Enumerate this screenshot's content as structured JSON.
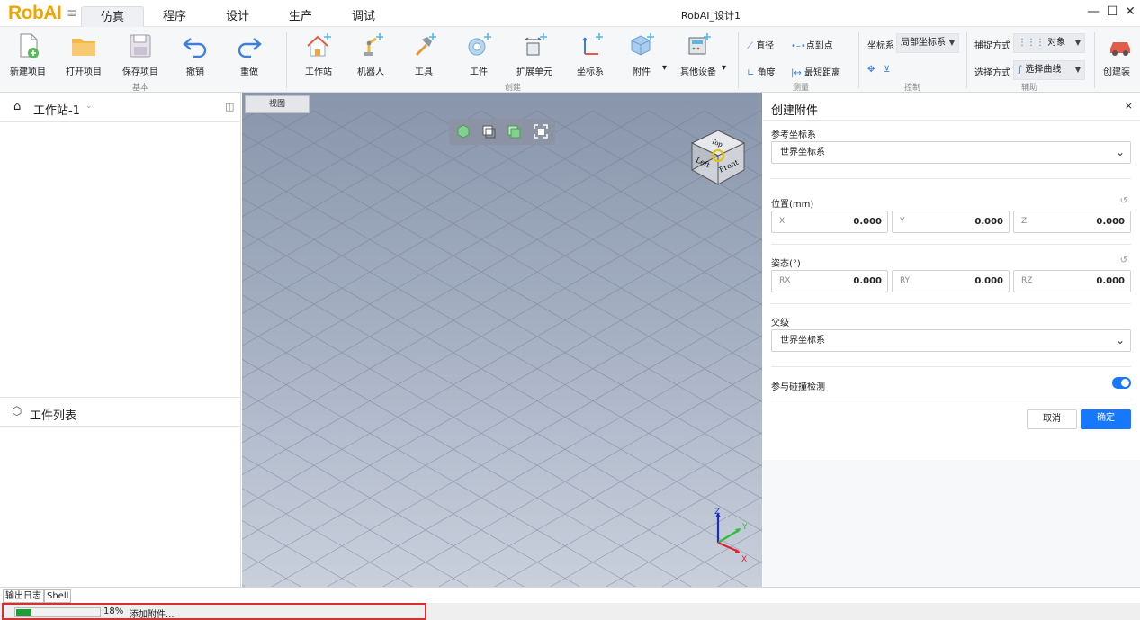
{
  "app": {
    "logo": "RobAI",
    "window_title": "RobAI_设计1"
  },
  "main_tabs": [
    "仿真",
    "程序",
    "设计",
    "生产",
    "调试"
  ],
  "active_tab_index": 0,
  "window_controls": {
    "minimize": "—",
    "maximize": "☐",
    "close": "✕"
  },
  "ribbon": {
    "basic": {
      "label": "基本",
      "buttons": [
        "新建项目",
        "打开项目",
        "保存项目",
        "撤销",
        "重做"
      ]
    },
    "create": {
      "label": "创建",
      "buttons": [
        "工作站",
        "机器人",
        "工具",
        "工件",
        "扩展单元",
        "坐标系",
        "附件",
        "其他设备"
      ]
    },
    "measure": {
      "label": "测量",
      "items": [
        "直径",
        "点到点",
        "角度",
        "最短距离"
      ]
    },
    "control": {
      "label": "控制",
      "coord_label": "坐标系",
      "coord_value": "局部坐标系"
    },
    "assist": {
      "label": "辅助",
      "capture_label": "捕捉方式",
      "capture_value": "对象",
      "select_label": "选择方式",
      "select_value": "选择曲线"
    },
    "overflow": "创建装"
  },
  "left_panel": {
    "workstation_title": "工作站-1",
    "part_list_title": "工件列表"
  },
  "viewport": {
    "tab_label": "视图",
    "cube_top": "Top",
    "cube_left": "Left",
    "cube_front": "Front",
    "axes": {
      "x": "X",
      "y": "Y",
      "z": "Z"
    }
  },
  "right_panel": {
    "title": "创建附件",
    "close": "×",
    "ref_coord_label": "参考坐标系",
    "ref_coord_value": "世界坐标系",
    "position_label": "位置(mm)",
    "position": [
      {
        "label": "X",
        "value": "0.000"
      },
      {
        "label": "Y",
        "value": "0.000"
      },
      {
        "label": "Z",
        "value": "0.000"
      }
    ],
    "pose_label": "姿态(°)",
    "pose": [
      {
        "label": "RX",
        "value": "0.000"
      },
      {
        "label": "RY",
        "value": "0.000"
      },
      {
        "label": "RZ",
        "value": "0.000"
      }
    ],
    "parent_label": "父级",
    "parent_value": "世界坐标系",
    "collision_label": "参与碰撞检测",
    "collision_enabled": true,
    "cancel": "取消",
    "confirm": "确定"
  },
  "bottom_tabs": [
    "输出日志",
    "Shell"
  ],
  "status": {
    "progress_percent": 18,
    "progress_text": "18%",
    "message": "添加附件..."
  },
  "colors": {
    "accent": "#1677ff",
    "logo": "#f0a500",
    "progress": "#1e9e3a",
    "highlight": "#d9302f"
  }
}
